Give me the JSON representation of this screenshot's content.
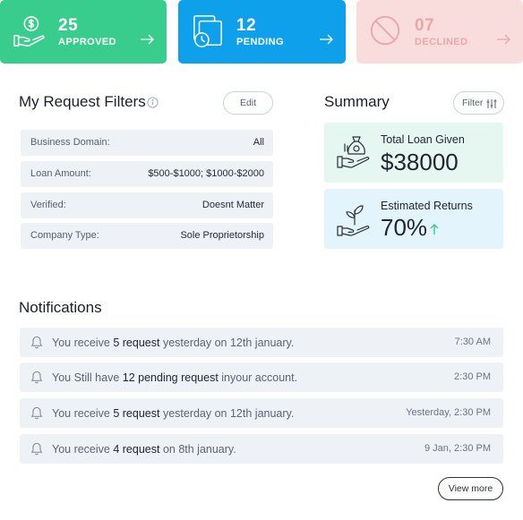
{
  "stats": [
    {
      "count": "25",
      "label": "APPROVED"
    },
    {
      "count": "12",
      "label": "PENDING"
    },
    {
      "count": "07",
      "label": "DECLINED"
    }
  ],
  "filters": {
    "title": "My Request Filters",
    "edit_label": "Edit",
    "rows": [
      {
        "key": "Business Domain:",
        "value": "All"
      },
      {
        "key": "Loan Amount:",
        "value": "$500-$1000; $1000-$2000"
      },
      {
        "key": "Verified:",
        "value": "Doesnt Matter"
      },
      {
        "key": "Company Type:",
        "value": "Sole Proprietorship"
      }
    ]
  },
  "summary": {
    "title": "Summary",
    "filter_label": "Filter",
    "loan": {
      "label": "Total Loan Given",
      "value": "$38000"
    },
    "returns": {
      "label": "Estimated Returns",
      "value": "70%"
    }
  },
  "notifications": {
    "title": "Notifications",
    "items": [
      {
        "pre": "You receive ",
        "bold": "5 request",
        "post": " yesterday on 12th january.",
        "time": "7:30 AM"
      },
      {
        "pre": "You Still have ",
        "bold": "12 pending request",
        "post": " inyour account.",
        "time": "2:30 PM"
      },
      {
        "pre": "You receive ",
        "bold": "5 request",
        "post": " yesterday on 12th january.",
        "time": "Yesterday, 2:30 PM"
      },
      {
        "pre": "You receive ",
        "bold": "4 request",
        "post": " on 8th january.",
        "time": "9 Jan, 2:30 PM"
      }
    ],
    "view_more": "View more"
  },
  "colors": {
    "approved": "#38cd8c",
    "pending": "#0fa0ec",
    "declined": "#f9dcdc",
    "loan_card": "#e5f7f0",
    "returns_card": "#e3f4fc"
  }
}
